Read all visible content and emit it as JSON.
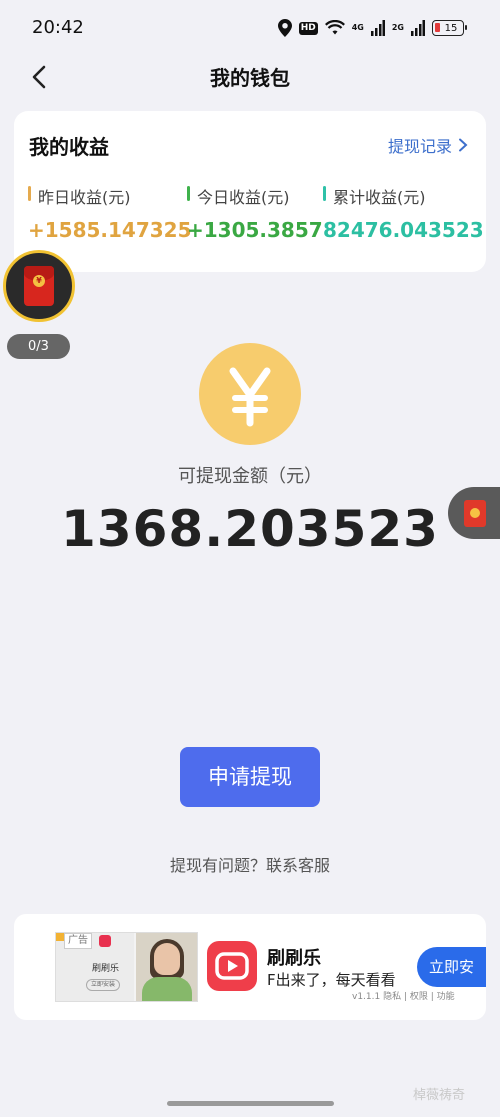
{
  "status_bar": {
    "time": "20:42",
    "hd_label": "HD",
    "net_1": "4G",
    "net_2": "2G",
    "battery": "15",
    "battery_low_color": "#e23b3b"
  },
  "header": {
    "title": "我的钱包",
    "back_icon": "chevron-left-icon"
  },
  "earnings": {
    "title": "我的收益",
    "records_link": "提现记录",
    "records_icon": "chevron-right-icon",
    "yesterday": {
      "label": "昨日收益(元)",
      "value": "+1585.147325",
      "color": "#e0a440"
    },
    "today": {
      "label": "今日收益(元)",
      "value": "+1305.3857",
      "color": "#3aa843"
    },
    "total": {
      "label": "累计收益(元)",
      "value": "82476.043523",
      "color": "#2cbfa2"
    }
  },
  "float_redpacket": {
    "icon": "red-packet-icon",
    "progress": "0/3"
  },
  "side_tab": {
    "icon": "red-packet-icon"
  },
  "balance": {
    "icon": "yuan-coin-icon",
    "label": "可提现金额（元）",
    "amount": "1368.203523"
  },
  "actions": {
    "withdraw_label": "申请提现",
    "withdraw_color": "#4e6ced",
    "help_text": "提现有问题？联系客服"
  },
  "ad": {
    "tag": "广告",
    "thumb_app_name": "刷刷乐",
    "thumb_button": "立即安装",
    "app_name": "刷刷乐",
    "description": "F出来了，每天看看",
    "meta": "v1.1.1 隐私 | 权限 | 功能",
    "install_label": "立即安",
    "install_color": "#2a6bea"
  },
  "watermark": "棹薇祷奇"
}
